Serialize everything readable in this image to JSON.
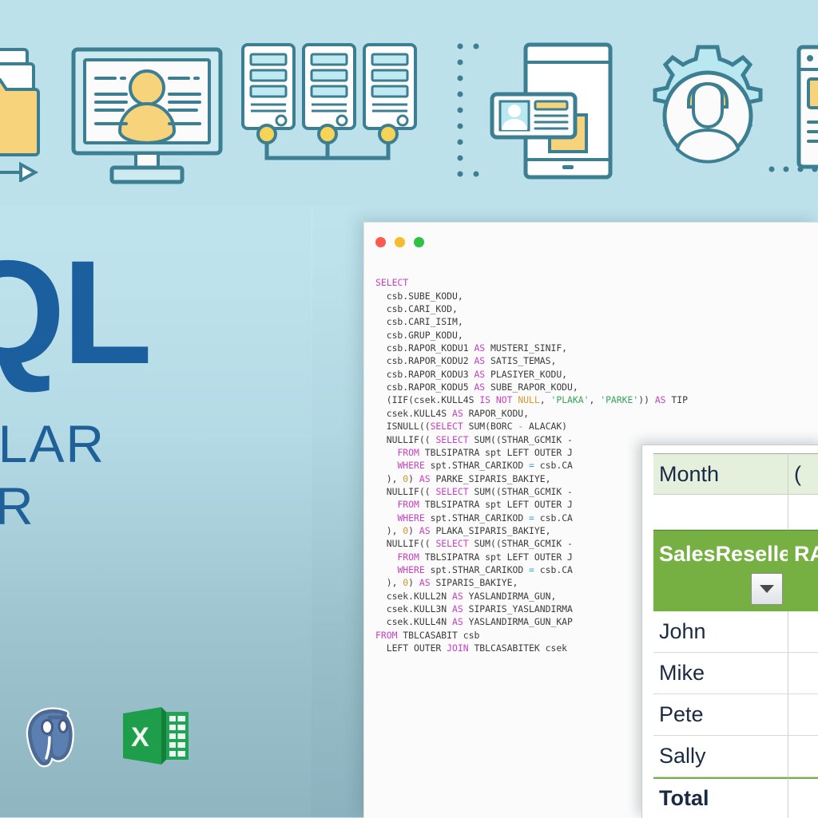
{
  "theme": {
    "bg_top": "#bde1ea",
    "bg_bottom": "#8fb5c1",
    "brand_blue": "#1c5f9e",
    "excel_green": "#76b043",
    "excel_header_green": "#e4efdc",
    "sql_keyword": "#c93fc4"
  },
  "hero": {
    "title": "QL",
    "subtitle_lines": [
      "ULAR",
      "AR"
    ],
    "logos": [
      "postgresql-logo",
      "excel-logo"
    ]
  },
  "icon_strip": {
    "icons": [
      "folder-transfer-icon",
      "desktop-user-profile-icon",
      "server-rack-cluster-icon",
      "tablet-id-card-icon",
      "gear-user-settings-icon",
      "browser-window-icon"
    ]
  },
  "code_window": {
    "traffic_lights": [
      "close-red",
      "minimize-yellow",
      "maximize-green"
    ],
    "language": "sql",
    "lines": [
      {
        "t": "SELECT",
        "p": "kw"
      },
      {
        "t": "  csb.SUBE_KODU,"
      },
      {
        "t": "  csb.CARI_KOD,"
      },
      {
        "t": "  csb.CARI_ISIM,"
      },
      {
        "t": "  csb.GRUP_KODU,"
      },
      {
        "t": "  csb.RAPOR_KODU1 ",
        "as": "AS",
        "t2": " MUSTERI_SINIF,"
      },
      {
        "t": "  csb.RAPOR_KODU2 ",
        "as": "AS",
        "t2": " SATIS_TEMAS,"
      },
      {
        "t": "  csb.RAPOR_KODU3 ",
        "as": "AS",
        "t2": " PLASIYER_KODU,"
      },
      {
        "t": "  csb.RAPOR_KODU5 ",
        "as": "AS",
        "t2": " SUBE_RAPOR_KODU,"
      },
      {
        "t": "  (IIF(csek.KULL4S IS NOT NULL, 'PLAKA', 'PARKE')) AS TIP"
      },
      {
        "t": "  csek.KULL4S AS RAPOR_KODU,"
      },
      {
        "t": "  ISNULL((SELECT SUM(BORC - ALACAK)"
      },
      {
        "t": "  NULLIF(( SELECT SUM((STHAR_GCMIK -"
      },
      {
        "t": "    FROM TBLSIPATRA spt LEFT OUTER J"
      },
      {
        "t": "    WHERE spt.STHAR_CARIKOD = csb.CA"
      },
      {
        "t": "  ), 0) AS PARKE_SIPARIS_BAKIYE,"
      },
      {
        "t": "  NULLIF(( SELECT SUM((STHAR_GCMIK -"
      },
      {
        "t": "    FROM TBLSIPATRA spt LEFT OUTER J"
      },
      {
        "t": "    WHERE spt.STHAR_CARIKOD = csb.CA"
      },
      {
        "t": "  ), 0) AS PLAKA_SIPARIS_BAKIYE,"
      },
      {
        "t": "  NULLIF(( SELECT SUM((STHAR_GCMIK -"
      },
      {
        "t": "    FROM TBLSIPATRA spt LEFT OUTER J"
      },
      {
        "t": "    WHERE spt.STHAR_CARIKOD = csb.CA"
      },
      {
        "t": "  ), 0) AS SIPARIS_BAKIYE,"
      },
      {
        "t": "  csek.KULL2N AS YASLANDIRMA_GUN,"
      },
      {
        "t": "  csek.KULL3N AS SIPARIS_YASLANDIRMA"
      },
      {
        "t": "  csek.KULL4N AS YASLANDIRMA_GUN_KAP"
      },
      {
        "t": "FROM TBLCASABIT csb"
      },
      {
        "t": "  LEFT OUTER JOIN TBLCASABITEK csek"
      }
    ]
  },
  "excel": {
    "header_row": {
      "col1": "Month",
      "col2": "("
    },
    "filter_label_line1": "Sales",
    "filter_label_line2": "Reseller",
    "filter_label_col2_line1": "R",
    "filter_label_col2_line2": "A",
    "filter_icon": "dropdown-filter-icon",
    "rows": [
      {
        "name": "John",
        "value": ""
      },
      {
        "name": "Mike",
        "value": ""
      },
      {
        "name": "Pete",
        "value": ""
      },
      {
        "name": "Sally",
        "value": ""
      }
    ],
    "total_label": "Total",
    "total_value": ""
  }
}
